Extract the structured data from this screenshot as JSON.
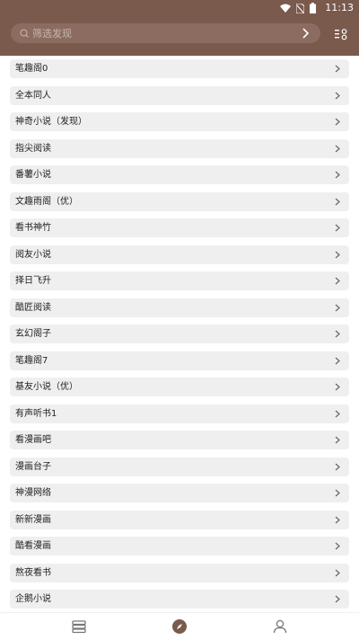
{
  "status_bar": {
    "time": "11:13"
  },
  "search": {
    "placeholder": "筛选发现"
  },
  "list": {
    "items": [
      {
        "label": "笔趣阁0"
      },
      {
        "label": "全本同人"
      },
      {
        "label": "神奇小说（发现）"
      },
      {
        "label": "指尖阅读"
      },
      {
        "label": "番薯小说"
      },
      {
        "label": "文趣雨阁（优）"
      },
      {
        "label": "看书神竹"
      },
      {
        "label": "阅友小说"
      },
      {
        "label": "择日飞升"
      },
      {
        "label": "酷匠阅读"
      },
      {
        "label": "玄幻阁子"
      },
      {
        "label": "笔趣阁7"
      },
      {
        "label": "基友小说（优）"
      },
      {
        "label": "有声听书1"
      },
      {
        "label": "看漫画吧"
      },
      {
        "label": "漫画台子"
      },
      {
        "label": "神漫网络"
      },
      {
        "label": "新新漫画"
      },
      {
        "label": "酷看漫画"
      },
      {
        "label": "熬夜看书"
      },
      {
        "label": "企鹅小说"
      }
    ]
  },
  "bottom_nav": {
    "tabs": [
      {
        "icon": "bookshelf-icon"
      },
      {
        "icon": "compass-icon",
        "active": true
      },
      {
        "icon": "person-icon"
      }
    ]
  },
  "colors": {
    "header": "#7a5a4d",
    "active": "#7a5a4d",
    "row_bg": "#efefef"
  }
}
